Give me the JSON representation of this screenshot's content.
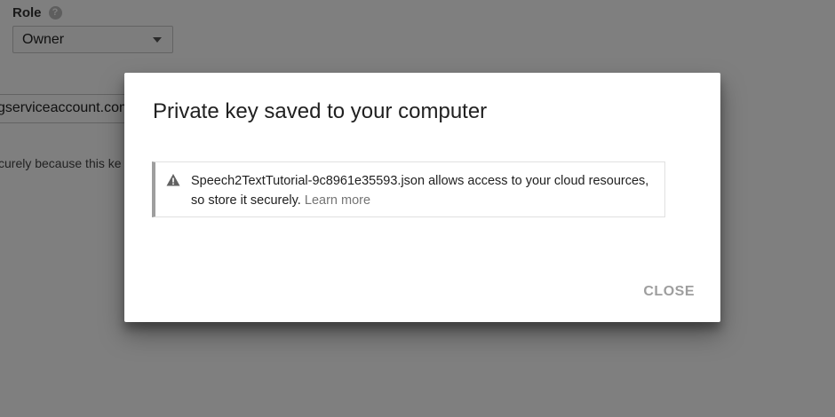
{
  "background": {
    "role_label": "Role",
    "role_help_icon": "?",
    "role_select_value": "Owner",
    "email_field_value": "gserviceaccount.com",
    "note_text": "curely because this ke"
  },
  "dialog": {
    "title": "Private key saved to your computer",
    "warning_icon": "warning-triangle-icon",
    "message": "Speech2TextTutorial-9c8961e35593.json allows access to your cloud resources, so store it securely.",
    "learn_more_label": "Learn more",
    "close_label": "CLOSE"
  },
  "colors": {
    "scrim": "#000000",
    "accent_bar": "#9e9e9e",
    "close_text": "#9e9e9e",
    "learn_more": "#757575"
  }
}
